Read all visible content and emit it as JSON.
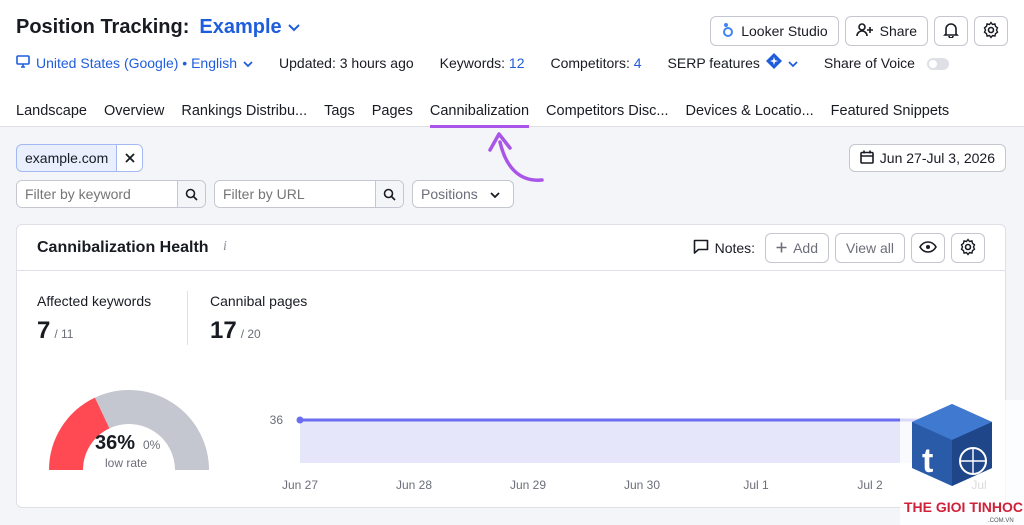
{
  "header": {
    "title": "Position Tracking:",
    "project": "Example",
    "looker_label": "Looker Studio",
    "share_label": "Share"
  },
  "meta": {
    "location": "United States (Google) • English",
    "updated": "Updated: 3 hours ago",
    "keywords_label": "Keywords:",
    "keywords_count": "12",
    "competitors_label": "Competitors:",
    "competitors_count": "4",
    "serp_label": "SERP features",
    "sov_label": "Share of Voice"
  },
  "tabs": [
    {
      "label": "Landscape"
    },
    {
      "label": "Overview"
    },
    {
      "label": "Rankings Distribu..."
    },
    {
      "label": "Tags"
    },
    {
      "label": "Pages"
    },
    {
      "label": "Cannibalization"
    },
    {
      "label": "Competitors Disc..."
    },
    {
      "label": "Devices & Locatio..."
    },
    {
      "label": "Featured Snippets"
    }
  ],
  "filters": {
    "domain_chip": "example.com",
    "date_range": "Jun 27-Jul 3, 2026",
    "keyword_placeholder": "Filter by keyword",
    "url_placeholder": "Filter by URL",
    "positions_label": "Positions"
  },
  "card": {
    "title": "Cannibalization Health",
    "info": "i",
    "notes_label": "Notes:",
    "add_label": "Add",
    "view_all_label": "View all",
    "affected_label": "Affected keywords",
    "affected_value": "7",
    "affected_total": "/ 11",
    "cannibal_label": "Cannibal pages",
    "cannibal_value": "17",
    "cannibal_total": "/ 20"
  },
  "gauge": {
    "percent_text": "36%",
    "change_text": "0%",
    "label": "low rate",
    "fraction": 0.36,
    "color_filled": "#ff4953",
    "color_rest": "#c4c7cf"
  },
  "chart_data": {
    "type": "area",
    "x": [
      "Jun 27",
      "Jun 28",
      "Jun 29",
      "Jun 30",
      "Jul 1",
      "Jul 2",
      "Jul 3"
    ],
    "y": [
      36,
      36,
      36,
      36,
      36,
      36,
      36
    ],
    "y_tick": "36",
    "line_color": "#6a6df0",
    "fill_color": "#e6e6fb"
  },
  "watermark": {
    "text": "THE GIOI TINHOC",
    "subtext": ".COM.VN",
    "letter": "t"
  }
}
